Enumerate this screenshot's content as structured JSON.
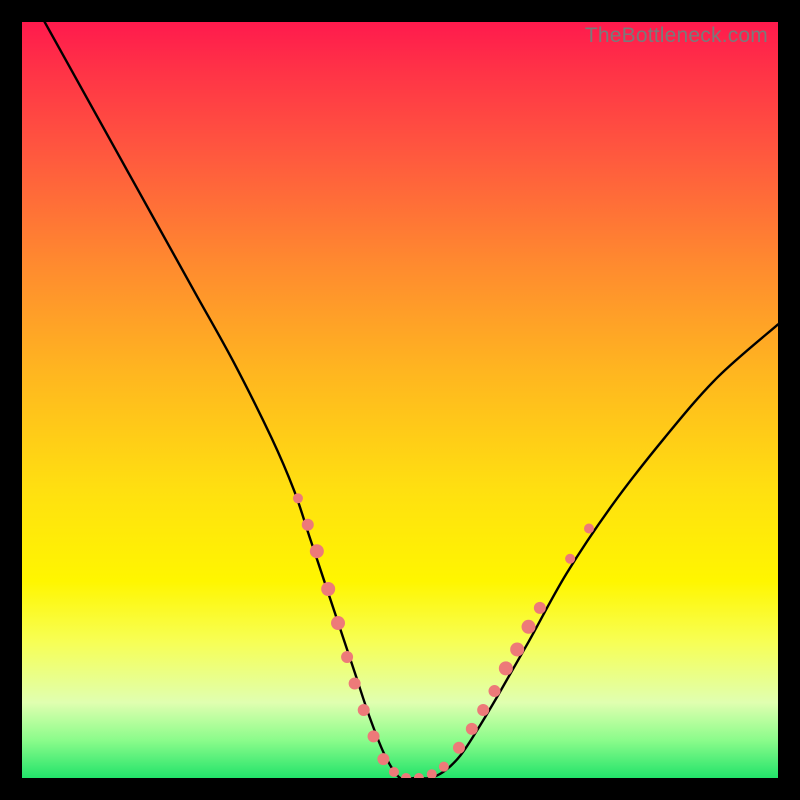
{
  "watermark": "TheBottleneck.com",
  "chart_data": {
    "type": "line",
    "title": "",
    "xlabel": "",
    "ylabel": "",
    "xlim": [
      0,
      100
    ],
    "ylim": [
      0,
      100
    ],
    "series": [
      {
        "name": "bottleneck-curve",
        "x": [
          3,
          8,
          13,
          18,
          23,
          28,
          33,
          36,
          38,
          40,
          42,
          44,
          46,
          48,
          50,
          52,
          54,
          56,
          58,
          60,
          63,
          67,
          72,
          78,
          85,
          92,
          100
        ],
        "y": [
          100,
          91,
          82,
          73,
          64,
          55,
          45,
          38,
          32,
          26,
          20,
          14,
          8,
          3,
          0,
          0,
          0,
          1,
          3,
          6,
          11,
          18,
          27,
          36,
          45,
          53,
          60
        ]
      }
    ],
    "markers": {
      "name": "highlighted-points",
      "color": "#ed7a79",
      "points": [
        {
          "x": 36.5,
          "y": 37.0,
          "r": 5
        },
        {
          "x": 37.8,
          "y": 33.5,
          "r": 6
        },
        {
          "x": 39.0,
          "y": 30.0,
          "r": 7
        },
        {
          "x": 40.5,
          "y": 25.0,
          "r": 7
        },
        {
          "x": 41.8,
          "y": 20.5,
          "r": 7
        },
        {
          "x": 43.0,
          "y": 16.0,
          "r": 6
        },
        {
          "x": 44.0,
          "y": 12.5,
          "r": 6
        },
        {
          "x": 45.2,
          "y": 9.0,
          "r": 6
        },
        {
          "x": 46.5,
          "y": 5.5,
          "r": 6
        },
        {
          "x": 47.8,
          "y": 2.5,
          "r": 6
        },
        {
          "x": 49.2,
          "y": 0.8,
          "r": 5
        },
        {
          "x": 50.8,
          "y": 0.0,
          "r": 5
        },
        {
          "x": 52.5,
          "y": 0.0,
          "r": 5
        },
        {
          "x": 54.2,
          "y": 0.5,
          "r": 5
        },
        {
          "x": 55.8,
          "y": 1.5,
          "r": 5
        },
        {
          "x": 57.8,
          "y": 4.0,
          "r": 6
        },
        {
          "x": 59.5,
          "y": 6.5,
          "r": 6
        },
        {
          "x": 61.0,
          "y": 9.0,
          "r": 6
        },
        {
          "x": 62.5,
          "y": 11.5,
          "r": 6
        },
        {
          "x": 64.0,
          "y": 14.5,
          "r": 7
        },
        {
          "x": 65.5,
          "y": 17.0,
          "r": 7
        },
        {
          "x": 67.0,
          "y": 20.0,
          "r": 7
        },
        {
          "x": 68.5,
          "y": 22.5,
          "r": 6
        },
        {
          "x": 72.5,
          "y": 29.0,
          "r": 5
        },
        {
          "x": 75.0,
          "y": 33.0,
          "r": 5
        }
      ]
    },
    "colors": {
      "curve": "#000000",
      "marker": "#ed7a79",
      "gradient_top": "#ff1a4d",
      "gradient_bottom": "#22e36a"
    }
  }
}
